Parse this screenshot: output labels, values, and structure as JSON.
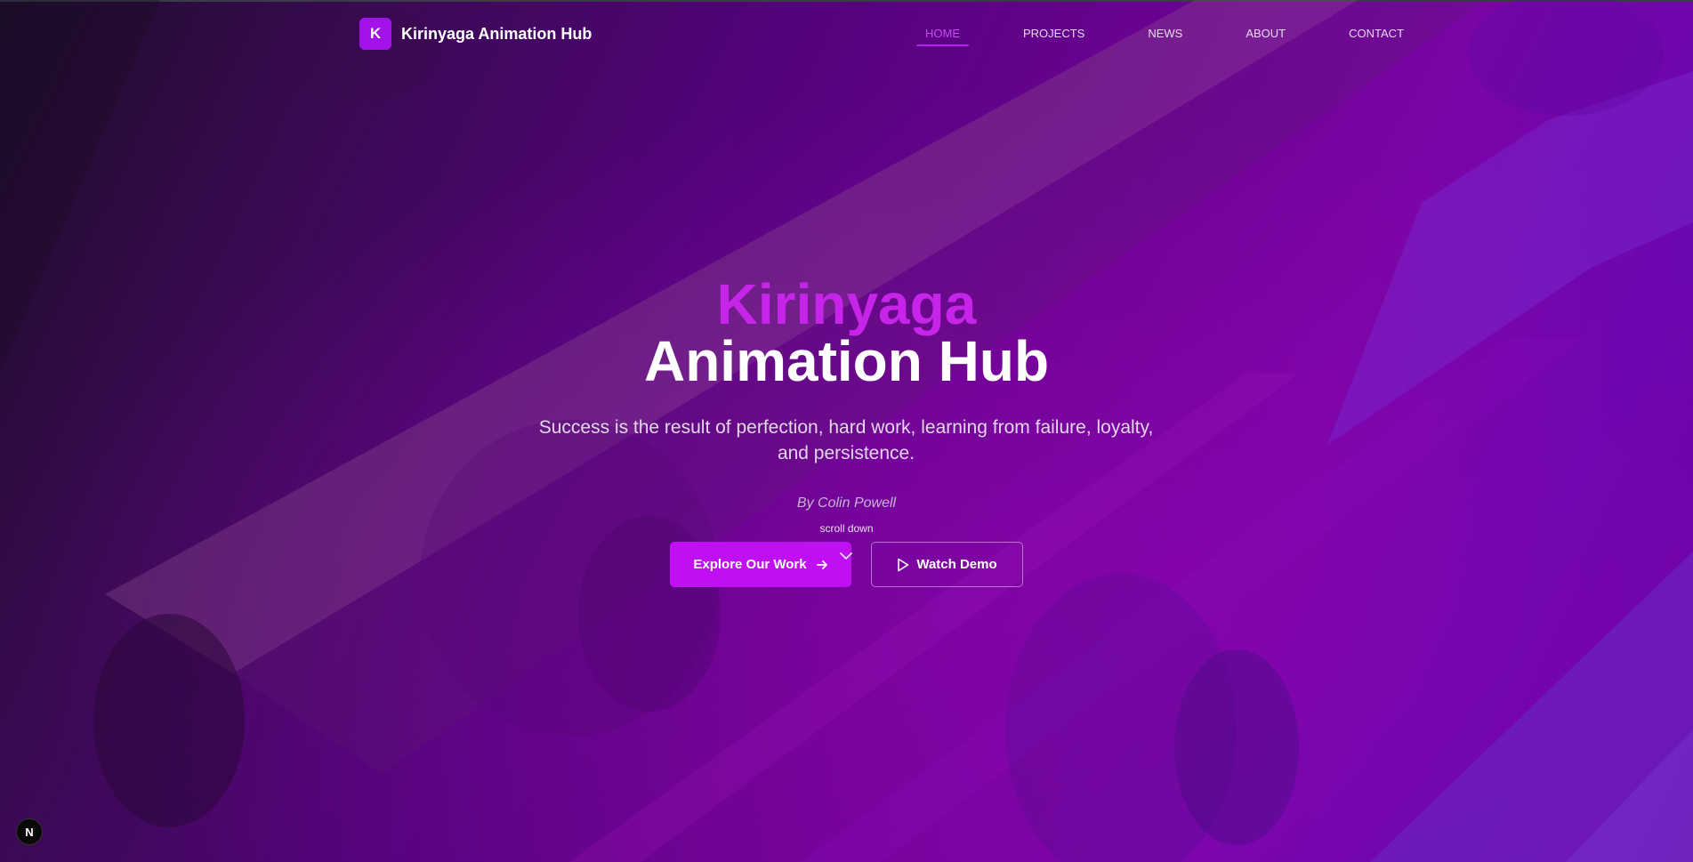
{
  "brand": {
    "logo_letter": "K",
    "name": "Kirinyaga Animation Hub"
  },
  "nav": {
    "items": [
      {
        "label": "HOME",
        "active": true
      },
      {
        "label": "PROJECTS",
        "active": false
      },
      {
        "label": "NEWS",
        "active": false
      },
      {
        "label": "ABOUT",
        "active": false
      },
      {
        "label": "CONTACT",
        "active": false
      }
    ]
  },
  "hero": {
    "title_accent": "Kirinyaga",
    "title_main": "Animation Hub",
    "quote": "Success is the result of perfection, hard work, learning from failure, loyalty, and persistence.",
    "author": "By Colin Powell",
    "scroll_hint": "scroll down",
    "primary_button": "Explore Our Work",
    "secondary_button": "Watch Demo"
  },
  "badge": {
    "letter": "N"
  },
  "colors": {
    "accent": "#c00ff0",
    "title_accent": "#c724ea",
    "logo_bg": "#a312e8"
  },
  "icons": {
    "primary_button_icon": "arrow-right-icon",
    "secondary_button_icon": "play-icon",
    "scroll_icon": "chevron-down-icon"
  }
}
